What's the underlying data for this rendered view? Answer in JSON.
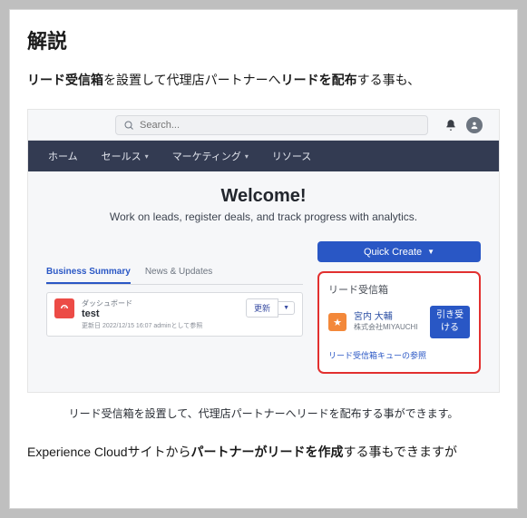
{
  "heading": "解説",
  "line1": {
    "bold1": "リード受信箱",
    "mid": "を設置して代理店パートナーへ",
    "bold2": "リードを配布",
    "tail": "する事も、"
  },
  "topbar": {
    "search_placeholder": "Search..."
  },
  "nav": {
    "home": "ホーム",
    "sales": "セールス",
    "marketing": "マーケティング",
    "resources": "リソース"
  },
  "hero": {
    "title": "Welcome!",
    "subtitle": "Work on leads, register deals, and track progress with analytics."
  },
  "quick_create": {
    "label": "Quick Create"
  },
  "lead_inbox": {
    "title": "リード受信箱",
    "person_name": "宮内 大輔",
    "company": "株式会社MIYAUCHI",
    "accept_btn": "引き受ける",
    "queue_link": "リード受信箱キューの参照"
  },
  "tabs": {
    "business": "Business Summary",
    "news": "News & Updates"
  },
  "dashboard": {
    "small": "ダッシュボード",
    "title": "test",
    "updated": "更新日 2022/12/15 16:07 adminとして参照",
    "refresh": "更新"
  },
  "caption": "リード受信箱を設置して、代理店パートナーへリードを配布する事ができます。",
  "line2": {
    "pre": "Experience Cloudサイトから",
    "bold": "パートナーがリードを作成",
    "post": "する事もできますが"
  }
}
